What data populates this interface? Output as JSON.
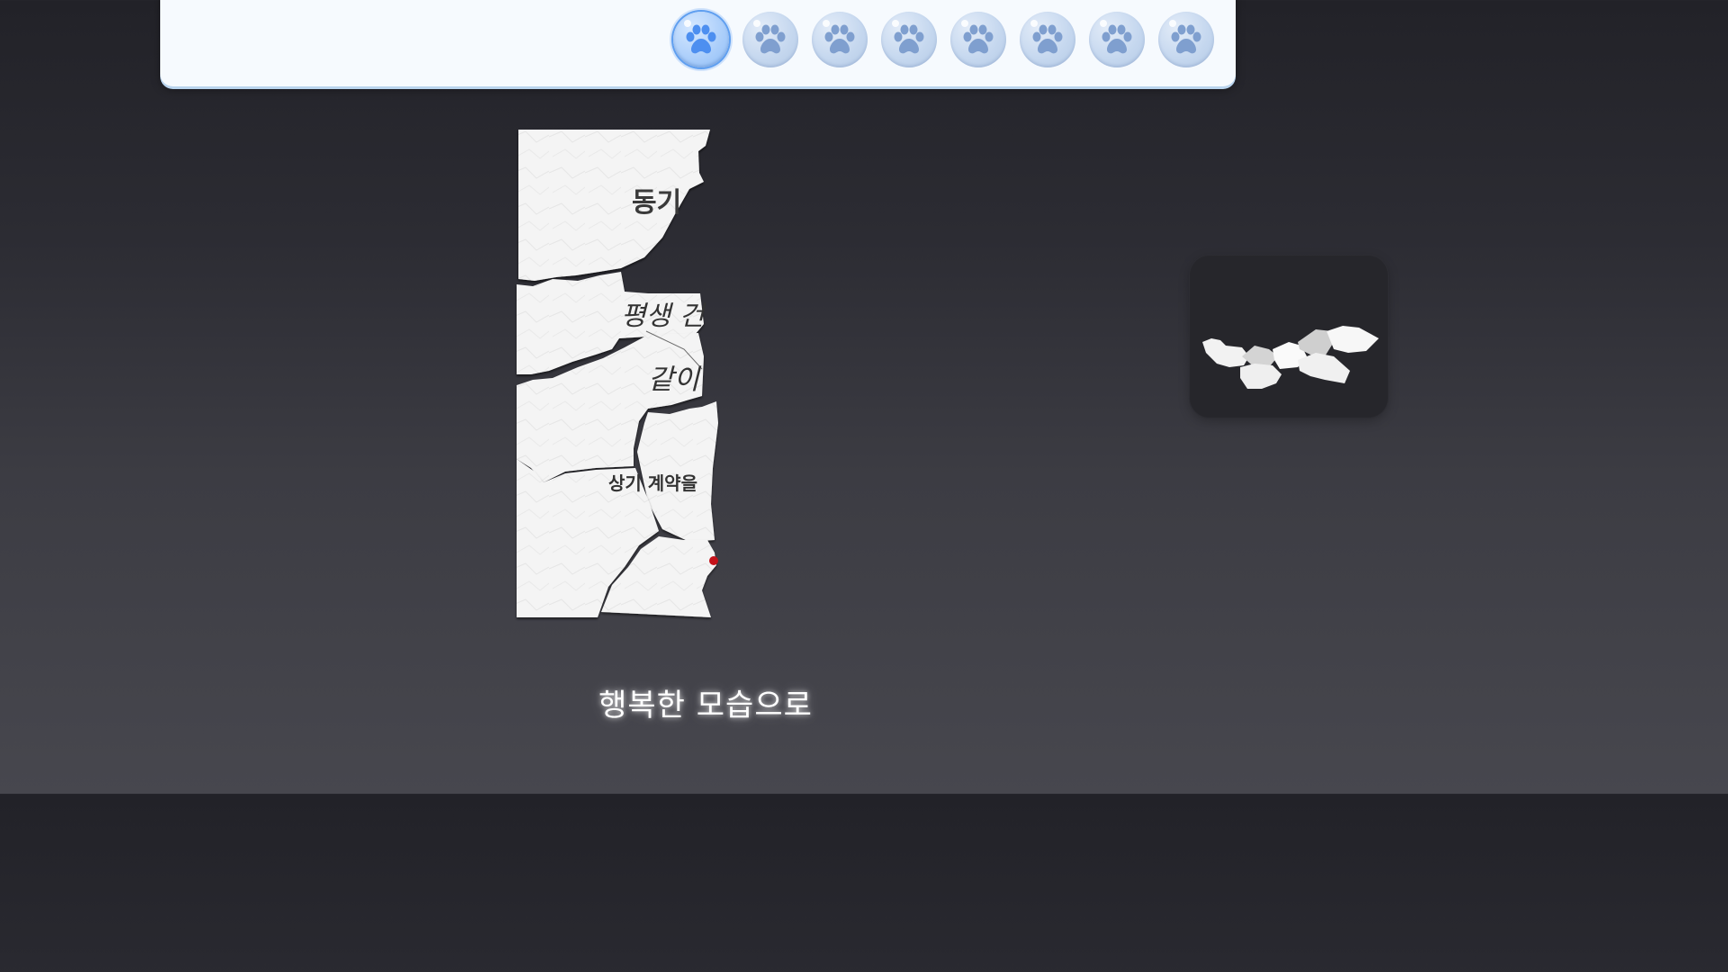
{
  "progress": {
    "total_steps": 8,
    "current_step": 1,
    "icon": "paw-icon"
  },
  "paper": {
    "fragment_1": "동기",
    "fragment_2": "평생 건",
    "fragment_3": "같이",
    "fragment_4": "상기 계약을"
  },
  "subtitle": "행복한 모습으로",
  "colors": {
    "paw_active": "#4d8ff0",
    "paw_inactive": "#7f9fcf",
    "seal_red": "#c4121a",
    "panel": "#f6fafe"
  }
}
